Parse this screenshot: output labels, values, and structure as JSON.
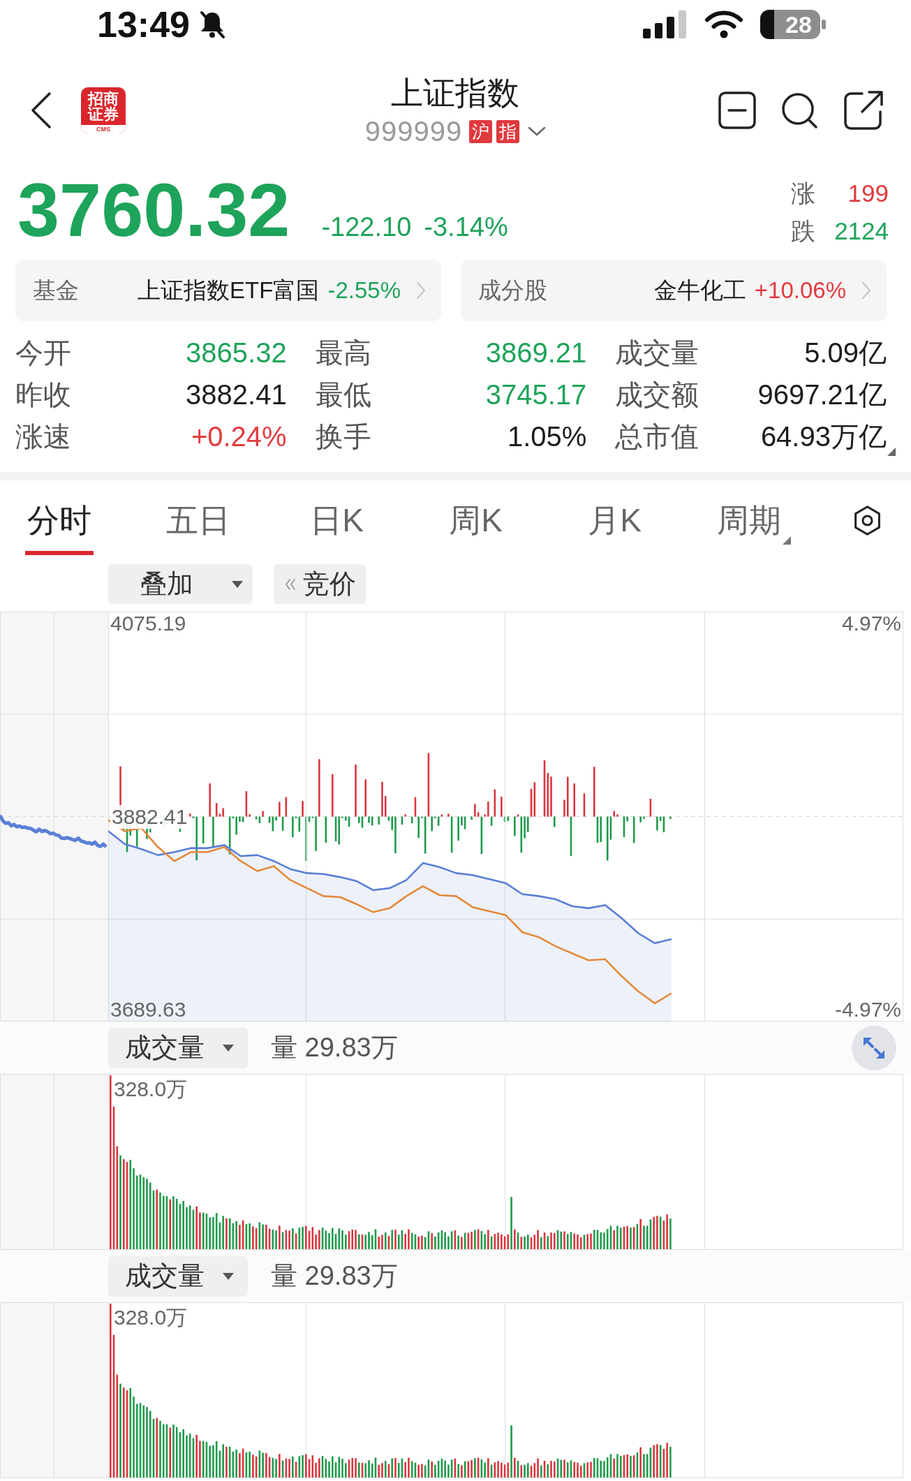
{
  "status_bar": {
    "time": "13:49",
    "battery": "28"
  },
  "header": {
    "logo": {
      "text": "招商证券",
      "caption": "CMS"
    },
    "title": "上证指数",
    "code": "999999",
    "badges": [
      "沪",
      "指"
    ]
  },
  "quote": {
    "price": "3760.32",
    "change": "-122.10",
    "change_pct": "-3.14%",
    "color": "#1ea35a",
    "breadth": [
      {
        "label": "涨",
        "value": "199",
        "color": "#e23b3f"
      },
      {
        "label": "跌",
        "value": "2124",
        "color": "#1ea35a"
      }
    ]
  },
  "related": [
    {
      "label": "基金",
      "name": "上证指数ETF富国",
      "change": "-2.55%",
      "color": "#1ea35a"
    },
    {
      "label": "成分股",
      "name": "金牛化工",
      "change": "+10.06%",
      "color": "#e23b3f"
    }
  ],
  "stats": [
    {
      "label": "今开",
      "value": "3865.32",
      "color": "#1ea35a"
    },
    {
      "label": "最高",
      "value": "3869.21",
      "color": "#1ea35a"
    },
    {
      "label": "成交量",
      "value": "5.09亿",
      "color": "#1c1c1c"
    },
    {
      "label": "昨收",
      "value": "3882.41",
      "color": "#1c1c1c"
    },
    {
      "label": "最低",
      "value": "3745.17",
      "color": "#1ea35a"
    },
    {
      "label": "成交额",
      "value": "9697.21亿",
      "color": "#1c1c1c"
    },
    {
      "label": "涨速",
      "value": "+0.24%",
      "color": "#e23b3f"
    },
    {
      "label": "换手",
      "value": "1.05%",
      "color": "#1c1c1c"
    },
    {
      "label": "总市值",
      "value": "64.93万亿",
      "color": "#1c1c1c"
    }
  ],
  "tabs": [
    {
      "label": "分时",
      "selected": true,
      "dropdown": false
    },
    {
      "label": "五日",
      "selected": false,
      "dropdown": false
    },
    {
      "label": "日K",
      "selected": false,
      "dropdown": false
    },
    {
      "label": "周K",
      "selected": false,
      "dropdown": false
    },
    {
      "label": "月K",
      "selected": false,
      "dropdown": false
    },
    {
      "label": "周期",
      "selected": false,
      "dropdown": true
    }
  ],
  "toolbar": {
    "overlay": "叠加",
    "auction": "竞价"
  },
  "intraday_chart": {
    "chart_data": {
      "type": "line",
      "grid": true,
      "ylim": [
        3677.78,
        4087.04
      ],
      "yticks": [
        {
          "value": 4075.19,
          "label": "4075.19"
        },
        {
          "value": 3882.41,
          "label": "3882.41"
        },
        {
          "value": 3689.63,
          "label": "3689.63"
        }
      ],
      "y2lim": [
        -5.28,
        5.28
      ],
      "y2ticks": [
        {
          "value": 4.97,
          "label": "4.97%"
        },
        {
          "value": -4.97,
          "label": "-4.97%"
        }
      ],
      "series": [
        {
          "type": "area",
          "color": "#5a7fd6",
          "values": [
            3868,
            3855,
            3850,
            3844,
            3847,
            3851,
            3851,
            3854,
            3843,
            3844,
            3838,
            3830,
            3826,
            3825,
            3822,
            3818,
            3809,
            3811,
            3819,
            3836,
            3832,
            3826,
            3824,
            3820,
            3816,
            3805,
            3803,
            3800,
            3793,
            3791,
            3794,
            3781,
            3766,
            3756,
            3760,
            null,
            null,
            null,
            null,
            null,
            null,
            null,
            null,
            null,
            null,
            null,
            null,
            null,
            null
          ]
        },
        {
          "type": "line",
          "color": "#e5893c",
          "values": [
            3879,
            3868,
            3871,
            3852,
            3838,
            3847,
            3847,
            3852,
            3838,
            3828,
            3833,
            3819,
            3811,
            3803,
            3802,
            3795,
            3787,
            3791,
            3803,
            3813,
            3804,
            3803,
            3792,
            3788,
            3784,
            3767,
            3762,
            3753,
            3746,
            3739,
            3740,
            3723,
            3708,
            3696,
            3706,
            null,
            null,
            null,
            null,
            null,
            null,
            null,
            null,
            null,
            null,
            null,
            null,
            null,
            null
          ]
        }
      ]
    }
  },
  "volume_panels": [
    {
      "indicator": "成交量",
      "reading": "量 29.83万",
      "max_label": "328.0万",
      "expand_control": true
    },
    {
      "indicator": "成交量",
      "reading": "量 29.83万",
      "max_label": "328.0万",
      "expand_control": false
    }
  ]
}
